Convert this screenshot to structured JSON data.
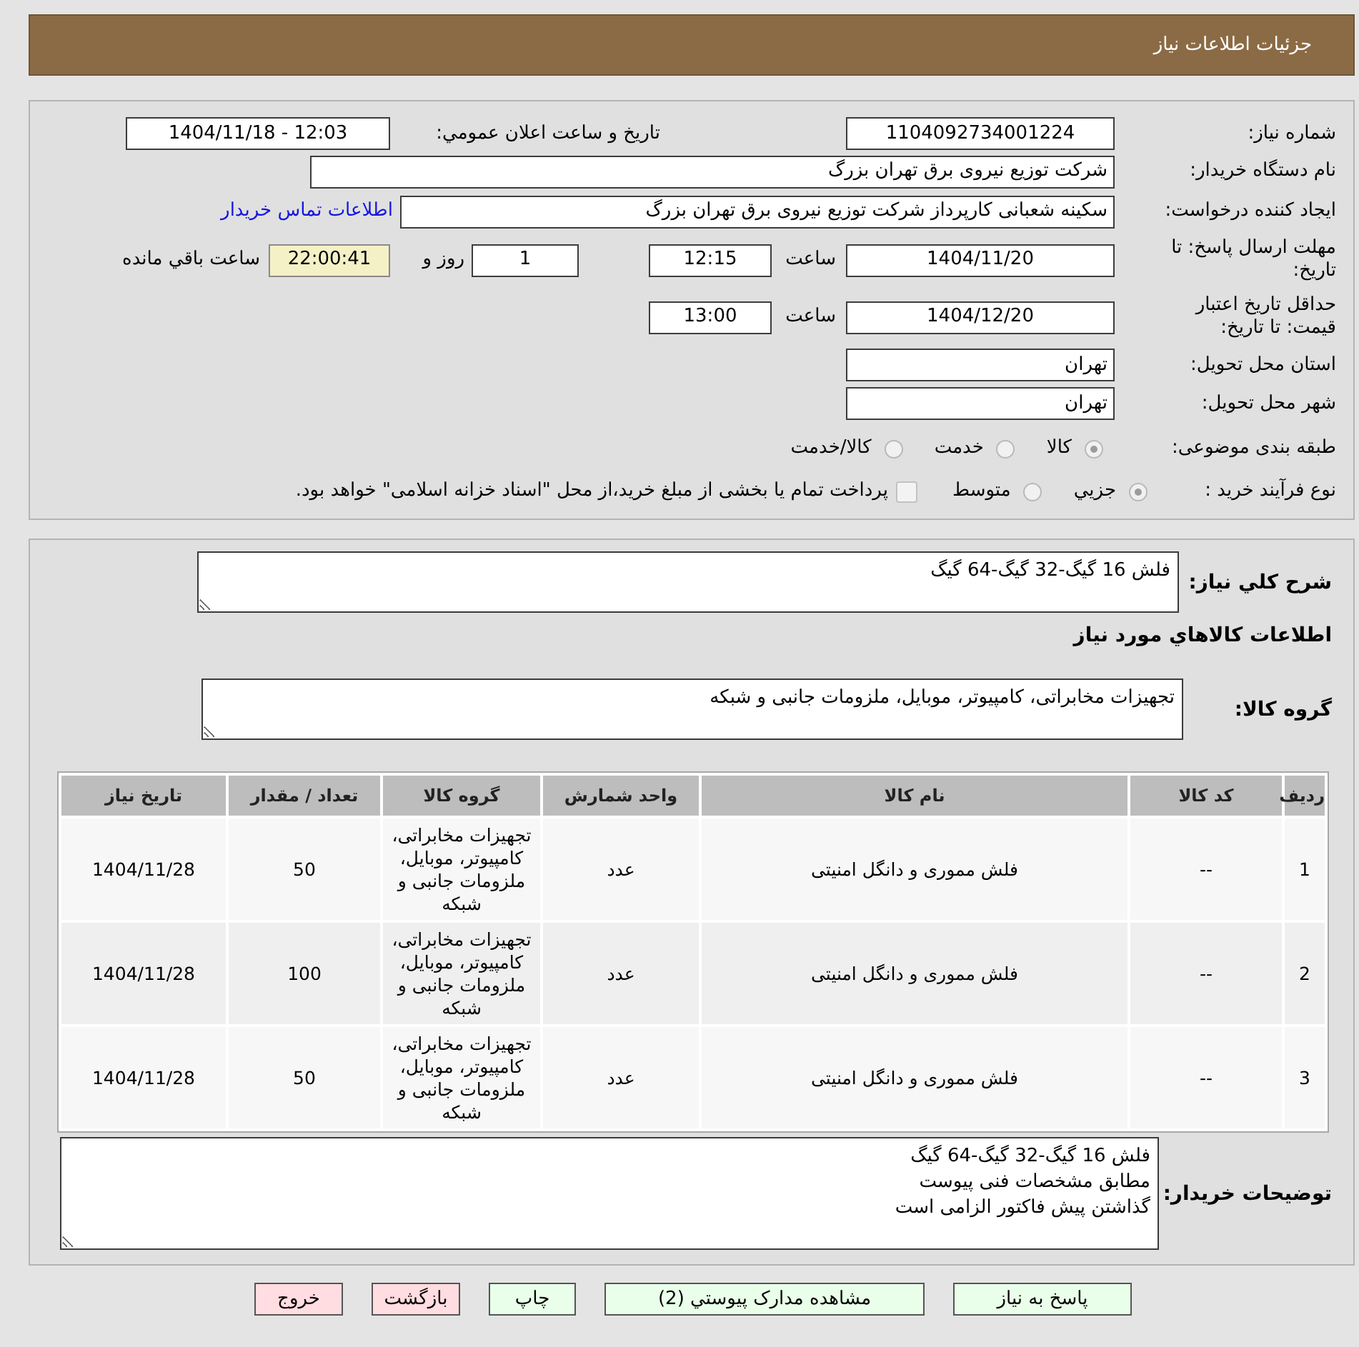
{
  "header": {
    "title": "جزئیات اطلاعات نیاز"
  },
  "details": {
    "need_number": {
      "label": "شماره نیاز:",
      "value": "1104092734001224"
    },
    "announcement": {
      "label": "تاریخ و ساعت اعلان عمومي:",
      "value": "1404/11/18 - 12:03"
    },
    "buyer_org": {
      "label": "نام دستگاه خریدار:",
      "value": "شرکت توزیع نیروی برق تهران بزرگ"
    },
    "requester": {
      "label": "ایجاد کننده درخواست:",
      "value": "سکینه شعبانی کارپرداز شرکت توزیع نیروی برق تهران بزرگ",
      "link": "اطلاعات تماس خریدار"
    },
    "response_deadline": {
      "label": "مهلت ارسال پاسخ: تا تاریخ:",
      "date": "1404/11/20",
      "time_label": "ساعت",
      "time": "12:15",
      "days": "1",
      "days_label": "روز و",
      "remaining": "22:00:41",
      "remaining_label": "ساعت باقي مانده"
    },
    "price_validity": {
      "label": "حداقل تاریخ اعتبار قیمت: تا تاریخ:",
      "date": "1404/12/20",
      "time_label": "ساعت",
      "time": "13:00"
    },
    "province": {
      "label": "استان محل تحویل:",
      "value": "تهران"
    },
    "city": {
      "label": "شهر محل تحویل:",
      "value": "تهران"
    },
    "category": {
      "label": "طبقه بندی موضوعی:",
      "options": [
        {
          "label": "کالا",
          "selected": true
        },
        {
          "label": "خدمت",
          "selected": false
        },
        {
          "label": "کالا/خدمت",
          "selected": false
        }
      ]
    },
    "process": {
      "label": "نوع فرآیند خرید :",
      "options": [
        {
          "label": "جزيي",
          "selected": true
        },
        {
          "label": "متوسط",
          "selected": false
        }
      ],
      "payment_option": {
        "label": "پرداخت تمام یا بخشی از مبلغ خرید،از محل \"اسناد خزانه اسلامی\" خواهد بود.",
        "checked": false
      }
    }
  },
  "summary": {
    "description": {
      "label": "شرح كلي نياز:",
      "value": "فلش 16 گیگ-32 گیگ-64 گیگ"
    },
    "goods_heading": "اطلاعات كالاهاي مورد نياز",
    "goods_group": {
      "label": "گروه کالا:",
      "value": "تجهیزات مخابراتی، کامپیوتر، موبایل، ملزومات جانبی و شبکه"
    },
    "table": {
      "columns": [
        "ردیف",
        "کد کالا",
        "نام کالا",
        "واحد شمارش",
        "گروه کالا",
        "تعداد / مقدار",
        "تاریخ نیاز"
      ],
      "rows": [
        [
          "1",
          "--",
          "فلش مموری و دانگل امنیتی",
          "عدد",
          "تجهیزات مخابراتی، کامپیوتر، موبایل، ملزومات جانبی و شبکه",
          "50",
          "1404/11/28"
        ],
        [
          "2",
          "--",
          "فلش مموری و دانگل امنیتی",
          "عدد",
          "تجهیزات مخابراتی، کامپیوتر، موبایل، ملزومات جانبی و شبکه",
          "100",
          "1404/11/28"
        ],
        [
          "3",
          "--",
          "فلش مموری و دانگل امنیتی",
          "عدد",
          "تجهیزات مخابراتی، کامپیوتر، موبایل، ملزومات جانبی و شبکه",
          "50",
          "1404/11/28"
        ]
      ]
    },
    "buyer_notes": {
      "label": "توضیحات خریدار:",
      "lines": [
        "فلش 16 گیگ-32 گیگ-64 گیگ",
        "مطابق مشخصات فنی پیوست",
        "گذاشتن پیش فاکتور الزامی است"
      ]
    }
  },
  "buttons": [
    {
      "label": "پاسخ به نیاز",
      "color": "#eaffea"
    },
    {
      "label": "مشاهده مدارک پیوستي (2)",
      "color": "#eaffea"
    },
    {
      "label": "چاپ",
      "color": "#eaffea"
    },
    {
      "label": "بازگشت",
      "color": "#ffdde1"
    },
    {
      "label": "خروج",
      "color": "#ffdde1"
    }
  ]
}
